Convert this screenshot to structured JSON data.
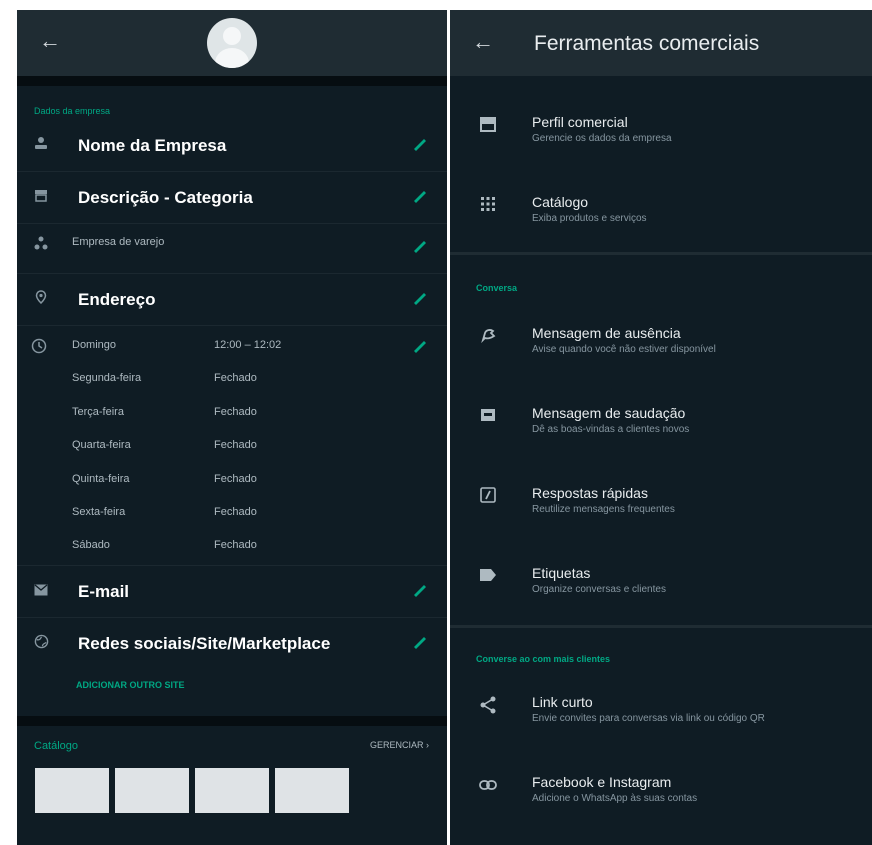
{
  "left": {
    "section_title": "Dados da empresa",
    "rows": [
      {
        "label": "Nome da Empresa",
        "icon": "person-icon"
      },
      {
        "label": "Descrição - Categoria",
        "icon": "store-icon"
      },
      {
        "label": "Empresa de varejo",
        "icon": "category-icon"
      },
      {
        "label": "Endereço",
        "icon": "location-pin-icon"
      }
    ],
    "hours": [
      {
        "day": "Domingo",
        "time": "12:00 – 12:02"
      },
      {
        "day": "Segunda-feira",
        "time": "Fechado"
      },
      {
        "day": "Terça-feira",
        "time": "Fechado"
      },
      {
        "day": "Quarta-feira",
        "time": "Fechado"
      },
      {
        "day": "Quinta-feira",
        "time": "Fechado"
      },
      {
        "day": "Sexta-feira",
        "time": "Fechado"
      },
      {
        "day": "Sábado",
        "time": "Fechado"
      }
    ],
    "email": "E-mail",
    "social": "Redes sociais/Site/Marketplace",
    "add_site": "ADICIONAR OUTRO SITE",
    "catalog_title": "Catálogo",
    "catalog_manage": "GERENCIAR ›"
  },
  "right": {
    "title": "Ferramentas comerciais",
    "items1": [
      {
        "title": "Perfil comercial",
        "sub": "Gerencie os dados da empresa",
        "icon": "store-icon"
      },
      {
        "title": "Catálogo",
        "sub": "Exiba produtos e serviços",
        "icon": "grid-icon"
      }
    ],
    "section2": "Conversa",
    "items2": [
      {
        "title": "Mensagem de ausência",
        "sub": "Avise quando você não estiver disponível",
        "icon": "away-icon"
      },
      {
        "title": "Mensagem de saudação",
        "sub": "Dê as boas-vindas a clientes novos",
        "icon": "greeting-icon"
      },
      {
        "title": "Respostas rápidas",
        "sub": "Reutilize mensagens frequentes",
        "icon": "quick-reply-icon"
      },
      {
        "title": "Etiquetas",
        "sub": "Organize conversas e clientes",
        "icon": "label-icon"
      }
    ],
    "section3": "Converse ao com mais clientes",
    "items3": [
      {
        "title": "Link curto",
        "sub": "Envie convites para conversas via link ou código QR",
        "icon": "share-icon"
      },
      {
        "title": "Facebook e Instagram",
        "sub": "Adicione o WhatsApp às suas contas",
        "icon": "link-icon"
      }
    ]
  },
  "colors": {
    "accent": "#00a884",
    "panel": "#0f1c24",
    "header": "#1f2c33"
  }
}
